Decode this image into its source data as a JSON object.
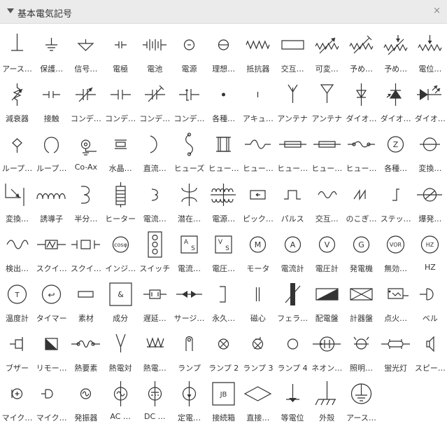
{
  "panel": {
    "title": "基本電気記号",
    "close_glyph": "×"
  },
  "items": [
    {
      "label": "アース…",
      "icon": "earth-icon"
    },
    {
      "label": "保護…",
      "icon": "protective-earth-icon"
    },
    {
      "label": "信号…",
      "icon": "signal-ground-icon"
    },
    {
      "label": "電極",
      "icon": "electrode-icon"
    },
    {
      "label": "電池",
      "icon": "battery-icon"
    },
    {
      "label": "電源",
      "icon": "power-source-icon"
    },
    {
      "label": "理想…",
      "icon": "ideal-source-icon"
    },
    {
      "label": "抵抗器",
      "icon": "resistor-icon"
    },
    {
      "label": "交互…",
      "icon": "alternate-resistor-icon"
    },
    {
      "label": "可変…",
      "icon": "variable-resistor-icon"
    },
    {
      "label": "予め…",
      "icon": "preset-resistor-icon"
    },
    {
      "label": "予め…",
      "icon": "preset-resistor-2-icon"
    },
    {
      "label": "電位…",
      "icon": "potentiometer-icon"
    },
    {
      "label": "減衰器",
      "icon": "attenuator-icon"
    },
    {
      "label": "接触",
      "icon": "contact-icon"
    },
    {
      "label": "コンデ…",
      "icon": "variable-capacitor-icon"
    },
    {
      "label": "コンデ…",
      "icon": "capacitor-icon"
    },
    {
      "label": "コンデ…",
      "icon": "trimmer-capacitor-icon"
    },
    {
      "label": "コンデ…",
      "icon": "polarized-capacitor-icon"
    },
    {
      "label": "各種…",
      "icon": "junction-dot-icon"
    },
    {
      "label": "アキュ…",
      "icon": "accumulator-icon"
    },
    {
      "label": "アンテナ",
      "icon": "antenna-icon"
    },
    {
      "label": "アンテナ",
      "icon": "antenna-2-icon"
    },
    {
      "label": "ダイオ…",
      "icon": "diode-icon"
    },
    {
      "label": "ダイオ…",
      "icon": "photodiode-icon"
    },
    {
      "label": "ダイオ…",
      "icon": "led-icon"
    },
    {
      "label": "ループ…",
      "icon": "loop-antenna-icon"
    },
    {
      "label": "ループ…",
      "icon": "loop-icon"
    },
    {
      "label": "Co-Ax",
      "icon": "coax-icon"
    },
    {
      "label": "水晶…",
      "icon": "crystal-icon"
    },
    {
      "label": "直流…",
      "icon": "dc-icon"
    },
    {
      "label": "ヒューズ",
      "icon": "fuse-icon"
    },
    {
      "label": "ヒュー…",
      "icon": "fuse-2-icon"
    },
    {
      "label": "ヒュー…",
      "icon": "fuse-3-icon"
    },
    {
      "label": "ヒュー…",
      "icon": "fuse-4-icon"
    },
    {
      "label": "ヒュー…",
      "icon": "fuse-5-icon"
    },
    {
      "label": "ヒュー…",
      "icon": "fuse-6-icon"
    },
    {
      "label": "各種…",
      "icon": "z-circle-icon"
    },
    {
      "label": "変換…",
      "icon": "converter-icon"
    },
    {
      "label": "変換…",
      "icon": "converter-2-icon"
    },
    {
      "label": "誘導子",
      "icon": "inductor-icon"
    },
    {
      "label": "半分…",
      "icon": "half-inductor-icon"
    },
    {
      "label": "ヒーター",
      "icon": "heater-icon"
    },
    {
      "label": "電流…",
      "icon": "current-icon"
    },
    {
      "label": "潜在…",
      "icon": "potential-transformer-icon"
    },
    {
      "label": "電源…",
      "icon": "power-transformer-icon"
    },
    {
      "label": "ピック…",
      "icon": "pickup-icon"
    },
    {
      "label": "パルス",
      "icon": "pulse-icon"
    },
    {
      "label": "交互…",
      "icon": "alternating-icon"
    },
    {
      "label": "のこぎ…",
      "icon": "sawtooth-icon"
    },
    {
      "label": "ステッ…",
      "icon": "step-icon"
    },
    {
      "label": "爆発…",
      "icon": "explosion-icon"
    },
    {
      "label": "検出…",
      "icon": "detector-icon"
    },
    {
      "label": "スクイ…",
      "icon": "squib-icon"
    },
    {
      "label": "スクイ…",
      "icon": "squib-2-icon"
    },
    {
      "label": "インジ…",
      "icon": "cos-phi-icon",
      "text": "cosφ"
    },
    {
      "label": "スイッチ",
      "icon": "switch-icon"
    },
    {
      "label": "電流…",
      "icon": "ammeter-box-icon",
      "text": "A",
      "sub": "S"
    },
    {
      "label": "電圧…",
      "icon": "voltmeter-box-icon",
      "text": "V",
      "sub": "S"
    },
    {
      "label": "モータ",
      "icon": "motor-icon",
      "text": "M"
    },
    {
      "label": "電流計",
      "icon": "ammeter-icon",
      "text": "A"
    },
    {
      "label": "電圧計",
      "icon": "voltmeter-icon",
      "text": "V"
    },
    {
      "label": "発電機",
      "icon": "generator-icon",
      "text": "G"
    },
    {
      "label": "無効…",
      "icon": "var-meter-icon",
      "text": "VOR"
    },
    {
      "label": "HZ",
      "icon": "frequency-meter-icon",
      "text": "HZ"
    },
    {
      "label": "温度計",
      "icon": "thermometer-icon",
      "text": "T"
    },
    {
      "label": "タイマー",
      "icon": "timer-icon",
      "text": "↩"
    },
    {
      "label": "素材",
      "icon": "material-icon"
    },
    {
      "label": "成分",
      "icon": "component-icon",
      "text": "&"
    },
    {
      "label": "遅延…",
      "icon": "delay-icon"
    },
    {
      "label": "サージ…",
      "icon": "surge-icon"
    },
    {
      "label": "永久…",
      "icon": "permanent-magnet-icon"
    },
    {
      "label": "磁心",
      "icon": "magnetic-core-icon"
    },
    {
      "label": "フェラ…",
      "icon": "ferrite-icon"
    },
    {
      "label": "配電盤",
      "icon": "distribution-board-icon"
    },
    {
      "label": "計器盤",
      "icon": "meter-board-icon"
    },
    {
      "label": "点火…",
      "icon": "igniter-icon"
    },
    {
      "label": "ベル",
      "icon": "bell-icon"
    },
    {
      "label": "ブザー",
      "icon": "buzzer-icon"
    },
    {
      "label": "リモー…",
      "icon": "remote-icon"
    },
    {
      "label": "熱要素",
      "icon": "thermal-element-icon"
    },
    {
      "label": "熱電対",
      "icon": "thermocouple-icon"
    },
    {
      "label": "熱電…",
      "icon": "thermopile-icon"
    },
    {
      "label": "ランプ",
      "icon": "lamp-icon"
    },
    {
      "label": "ランプ 2",
      "icon": "lamp-2-icon"
    },
    {
      "label": "ランプ 3",
      "icon": "lamp-3-icon"
    },
    {
      "label": "ランプ 4",
      "icon": "lamp-4-icon"
    },
    {
      "label": "ネオン…",
      "icon": "neon-lamp-icon"
    },
    {
      "label": "照明…",
      "icon": "lighting-icon"
    },
    {
      "label": "蛍光灯",
      "icon": "fluorescent-icon"
    },
    {
      "label": "スピー…",
      "icon": "speaker-icon"
    },
    {
      "label": "マイク…",
      "icon": "microphone-icon"
    },
    {
      "label": "マイク…",
      "icon": "microphone-2-icon"
    },
    {
      "label": "発振器",
      "icon": "oscillator-icon"
    },
    {
      "label": "AC …",
      "icon": "ac-source-icon"
    },
    {
      "label": "DC …",
      "icon": "dc-source-icon"
    },
    {
      "label": "定電…",
      "icon": "constant-current-icon"
    },
    {
      "label": "接続箱",
      "icon": "junction-box-icon",
      "text": "JB"
    },
    {
      "label": "直接…",
      "icon": "direct-icon"
    },
    {
      "label": "等電位",
      "icon": "equipotential-icon"
    },
    {
      "label": "外殻",
      "icon": "chassis-icon"
    },
    {
      "label": "アース…",
      "icon": "earth-circle-icon"
    }
  ]
}
